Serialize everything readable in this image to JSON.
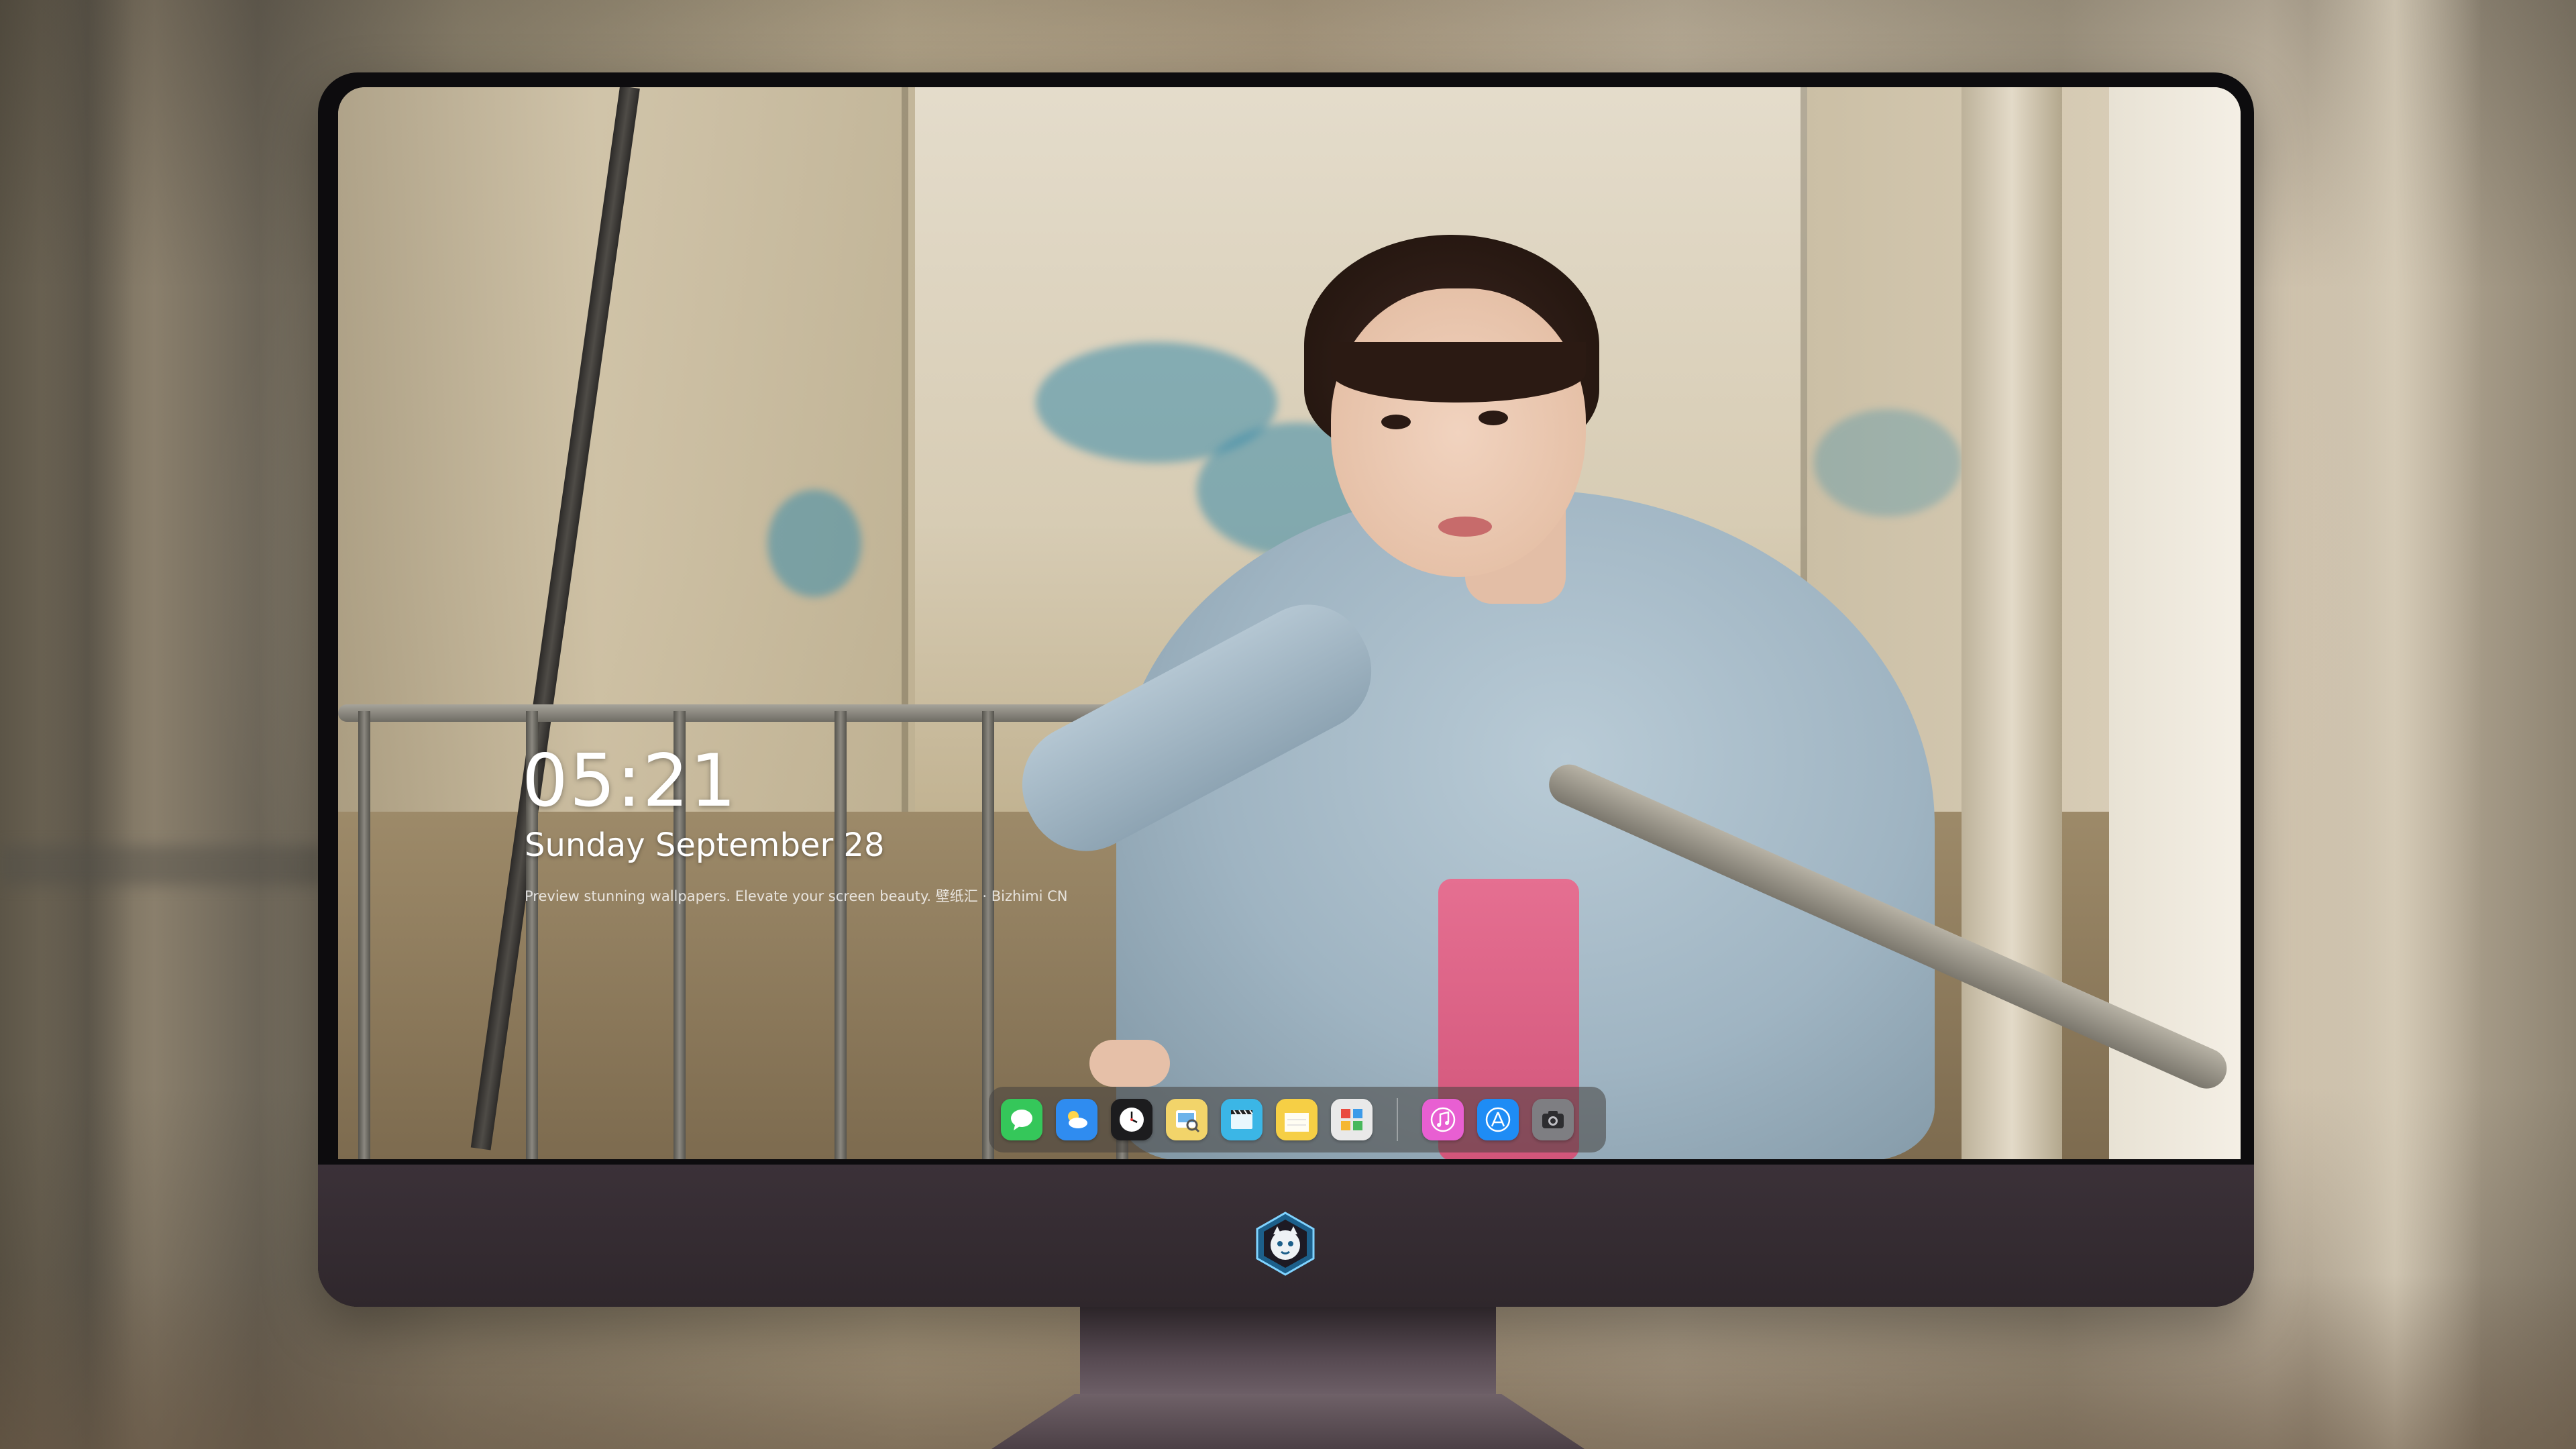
{
  "lockscreen": {
    "time": "05:21",
    "date": "Sunday September  28",
    "tagline": "Preview stunning wallpapers. Elevate your screen beauty. 壁纸汇 · Bizhimi CN"
  },
  "dock": {
    "apps": [
      {
        "name": "messages-icon",
        "color": "#35c75a"
      },
      {
        "name": "weather-icon",
        "color": "#2f8cf0"
      },
      {
        "name": "clock-icon",
        "color": "#1c1c1e"
      },
      {
        "name": "preview-icon",
        "color": "#f2d46a"
      },
      {
        "name": "clips-icon",
        "color": "#3bb6e6"
      },
      {
        "name": "notes-icon",
        "color": "#f6cf45"
      },
      {
        "name": "photo-booth-icon",
        "color": "#e9e9e9"
      },
      {
        "name": "itunes-icon",
        "color": "#e85fd2"
      },
      {
        "name": "app-store-icon",
        "color": "#1e8cf5"
      },
      {
        "name": "screenshot-icon",
        "color": "#7e7e82"
      }
    ]
  },
  "monitor": {
    "logo": "dragon-mascot-logo"
  }
}
